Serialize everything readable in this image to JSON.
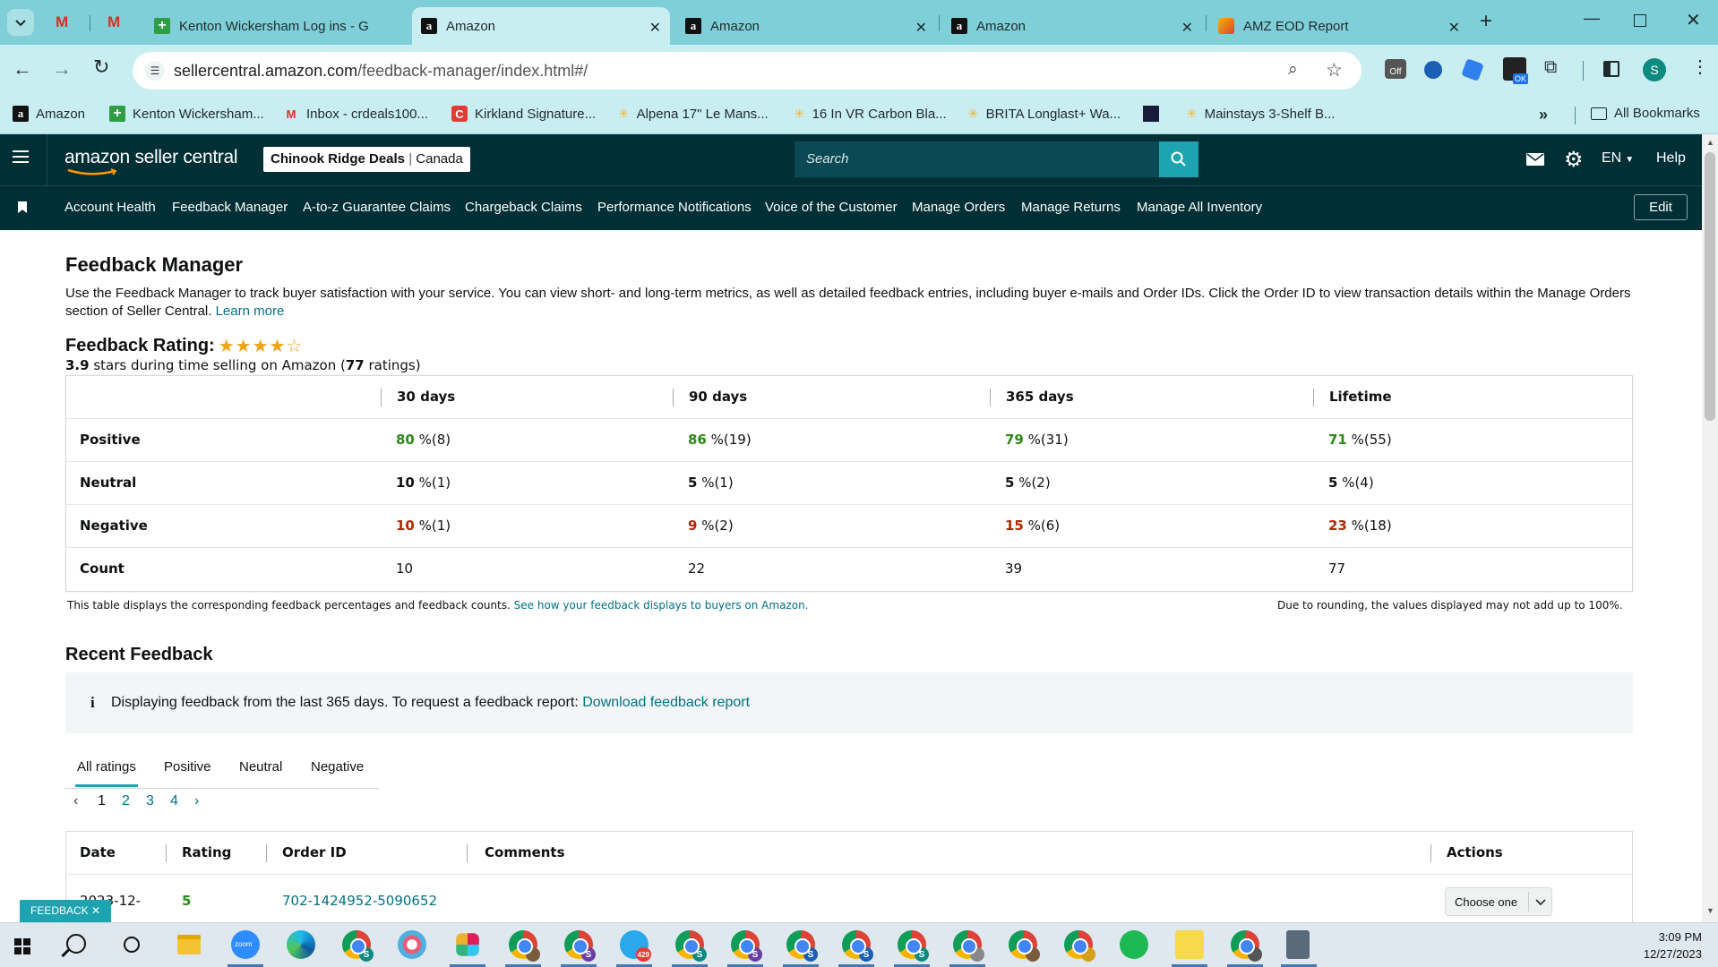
{
  "browser": {
    "tabs": [
      {
        "title": "Kenton Wickersham Log ins - G",
        "icon": "sheets-icon"
      },
      {
        "title": "Amazon",
        "icon": "amazon-icon",
        "active": true
      },
      {
        "title": "Amazon",
        "icon": "amazon-icon"
      },
      {
        "title": "Amazon",
        "icon": "amazon-icon"
      },
      {
        "title": "AMZ EOD Report",
        "icon": "report-icon"
      }
    ],
    "url_host": "sellercentral.amazon.com",
    "url_path": "/feedback-manager/index.html#/",
    "profile_initial": "S",
    "bookmarks": [
      {
        "label": "Amazon",
        "icon": "amazon-icon"
      },
      {
        "label": "Kenton Wickersham...",
        "icon": "sheets-icon"
      },
      {
        "label": "Inbox - crdeals100...",
        "icon": "gmail-icon"
      },
      {
        "label": "Kirkland Signature...",
        "icon": "red-c-icon"
      },
      {
        "label": "Alpena 17\" Le Mans...",
        "icon": "sparkle-icon"
      },
      {
        "label": "16 In VR Carbon Bla...",
        "icon": "sparkle-icon"
      },
      {
        "label": "BRITA Longlast+ Wa...",
        "icon": "sparkle-icon"
      },
      {
        "label": "",
        "icon": "dark-square-icon"
      },
      {
        "label": "Mainstays 3-Shelf B...",
        "icon": "sparkle-icon"
      }
    ],
    "all_bookmarks": "All Bookmarks"
  },
  "header": {
    "logo_text": "amazon seller central",
    "store_name": "Chinook Ridge Deals",
    "store_region": "Canada",
    "search_placeholder": "Search",
    "language": "EN",
    "help": "Help"
  },
  "nav": {
    "items": [
      "Account Health",
      "Feedback Manager",
      "A-to-z Guarantee Claims",
      "Chargeback Claims",
      "Performance Notifications",
      "Voice of the Customer",
      "Manage Orders",
      "Manage Returns",
      "Manage All Inventory"
    ],
    "edit": "Edit"
  },
  "page": {
    "title": "Feedback Manager",
    "description": "Use the Feedback Manager to track buyer satisfaction with your service. You can view short- and long-term metrics, as well as detailed feedback entries, including buyer e-mails and Order IDs. Click the Order ID to view transaction details within the Manage Orders section of Seller Central.",
    "learn_more": "Learn more",
    "rating_label": "Feedback Rating:",
    "stars_value": "3.9",
    "stars_text_a": " stars during time selling on Amazon (",
    "ratings_count": "77",
    "stars_text_b": " ratings)",
    "star_rating": 3.9
  },
  "rating_table": {
    "columns": [
      "30 days",
      "90 days",
      "365 days",
      "Lifetime"
    ],
    "rows": [
      {
        "label": "Positive",
        "cells": [
          {
            "pct": "80",
            "rest": " %(8)"
          },
          {
            "pct": "86",
            "rest": " %(19)"
          },
          {
            "pct": "79",
            "rest": " %(31)"
          },
          {
            "pct": "71",
            "rest": " %(55)"
          }
        ]
      },
      {
        "label": "Neutral",
        "cells": [
          {
            "pct": "10",
            "rest": " %(1)"
          },
          {
            "pct": "5",
            "rest": " %(1)"
          },
          {
            "pct": "5",
            "rest": " %(2)"
          },
          {
            "pct": "5",
            "rest": " %(4)"
          }
        ]
      },
      {
        "label": "Negative",
        "cells": [
          {
            "pct": "10",
            "rest": " %(1)"
          },
          {
            "pct": "9",
            "rest": " %(2)"
          },
          {
            "pct": "15",
            "rest": " %(6)"
          },
          {
            "pct": "23",
            "rest": " %(18)"
          }
        ]
      },
      {
        "label": "Count",
        "cells": [
          {
            "pct": "",
            "rest": "10"
          },
          {
            "pct": "",
            "rest": "22"
          },
          {
            "pct": "",
            "rest": "39"
          },
          {
            "pct": "",
            "rest": "77"
          }
        ]
      }
    ],
    "footnote": "This table displays the corresponding feedback percentages and feedback counts.",
    "footnote_link": "See how your feedback displays to buyers on Amazon.",
    "rounding_note": "Due to rounding, the values displayed may not add up to 100%."
  },
  "recent": {
    "title": "Recent Feedback",
    "info_text": "Displaying feedback from the last 365 days. To request a feedback report:",
    "info_link": "Download feedback report",
    "filters": [
      "All ratings",
      "Positive",
      "Neutral",
      "Negative"
    ],
    "pages": [
      "1",
      "2",
      "3",
      "4"
    ],
    "columns": [
      "Date",
      "Rating",
      "Order ID",
      "Comments",
      "Actions"
    ],
    "first_row": {
      "date": "2023-12-",
      "rating": "5",
      "order_id": "702-1424952-5090652",
      "action": "Choose one"
    }
  },
  "feedback_tab": "FEEDBACK",
  "colors": {
    "positive": "#2a8a13",
    "negative": "#b12704",
    "header_bg": "#002f36",
    "link": "#007185"
  },
  "taskbar": {
    "time": "3:09 PM",
    "date": "12/27/2023",
    "telegram_badge": "429"
  }
}
